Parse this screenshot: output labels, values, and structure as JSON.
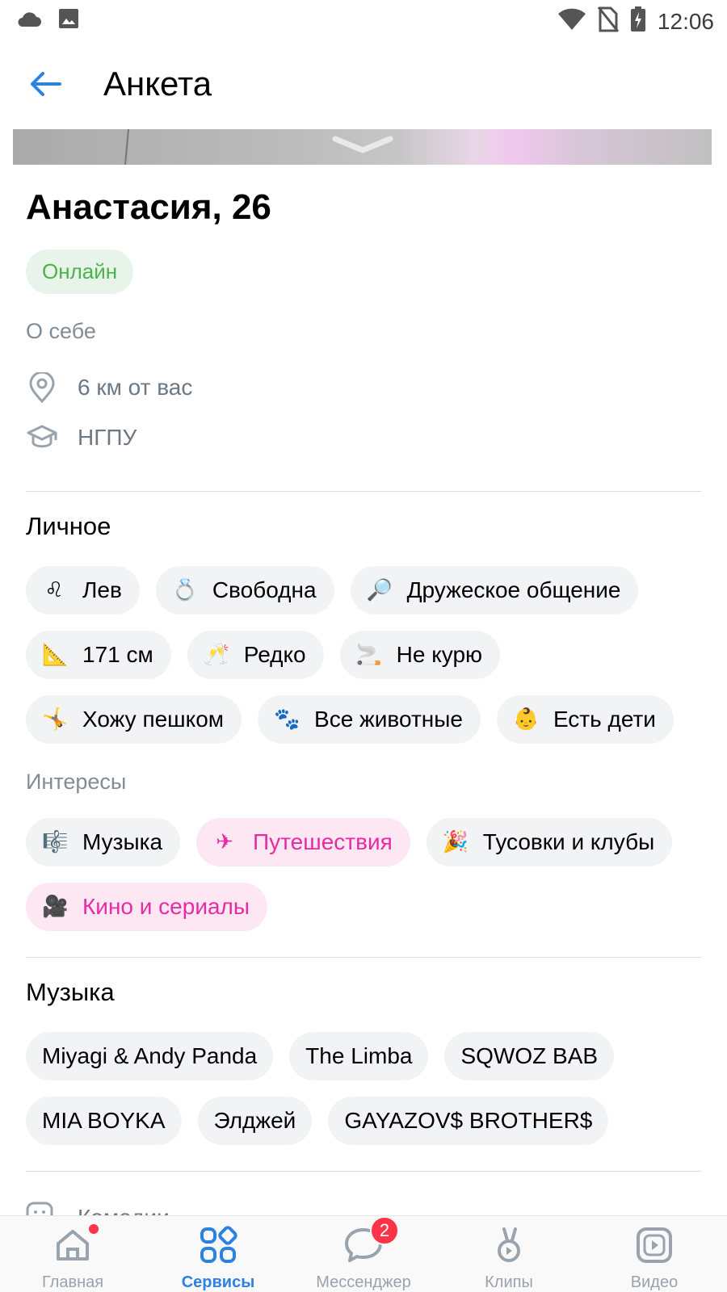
{
  "status_bar": {
    "time": "12:06",
    "icons": [
      "cloud-icon",
      "image-icon",
      "wifi-icon",
      "no-sim-icon",
      "battery-icon"
    ]
  },
  "app_bar": {
    "title": "Анкета",
    "back_icon": "arrow-left-icon"
  },
  "profile": {
    "name": "Анастасия, 26",
    "online": "Онлайн",
    "about_label": "О себе",
    "distance": "6 км от вас",
    "education": "НГПУ"
  },
  "personal": {
    "title": "Личное",
    "chips": [
      {
        "emoji": "♌",
        "label": "Лев"
      },
      {
        "emoji": "💍",
        "label": "Свободна"
      },
      {
        "emoji": "🔎",
        "label": "Дружеское общение"
      },
      {
        "emoji": "📐",
        "label": "171 см"
      },
      {
        "emoji": "🥂",
        "label": "Редко"
      },
      {
        "emoji": "🚬",
        "label": "Не курю"
      },
      {
        "emoji": "🤸",
        "label": "Хожу пешком"
      },
      {
        "emoji": "🐾",
        "label": "Все животные"
      },
      {
        "emoji": "👶",
        "label": "Есть дети"
      }
    ]
  },
  "interests": {
    "label": "Интересы",
    "chips": [
      {
        "emoji": "🎼",
        "label": "Музыка",
        "highlight": false
      },
      {
        "emoji": "✈",
        "label": "Путешествия",
        "highlight": true
      },
      {
        "emoji": "🎉",
        "label": "Тусовки и клубы",
        "highlight": false
      },
      {
        "emoji": "🎥",
        "label": "Кино и сериалы",
        "highlight": true
      }
    ]
  },
  "music": {
    "title": "Музыка",
    "artists": [
      "Miyagi & Andy Panda",
      "The Limba",
      "SQWOZ BAB",
      "MIA BOYKA",
      "Элджей",
      "GAYAZOV$ BROTHER$"
    ]
  },
  "peek_row": {
    "label": "Комедии"
  },
  "bottom_nav": {
    "items": [
      {
        "label": "Главная",
        "icon": "home-icon"
      },
      {
        "label": "Сервисы",
        "icon": "services-icon"
      },
      {
        "label": "Мессенджер",
        "icon": "messenger-icon"
      },
      {
        "label": "Клипы",
        "icon": "clips-icon"
      },
      {
        "label": "Видео",
        "icon": "video-icon"
      }
    ],
    "active_index": 1,
    "messenger_badge": "2"
  },
  "colors": {
    "accent": "#2d81e0",
    "online_green": "#4bb34b",
    "highlight_pink": "#e62ca5",
    "badge_red": "#ff3347"
  }
}
